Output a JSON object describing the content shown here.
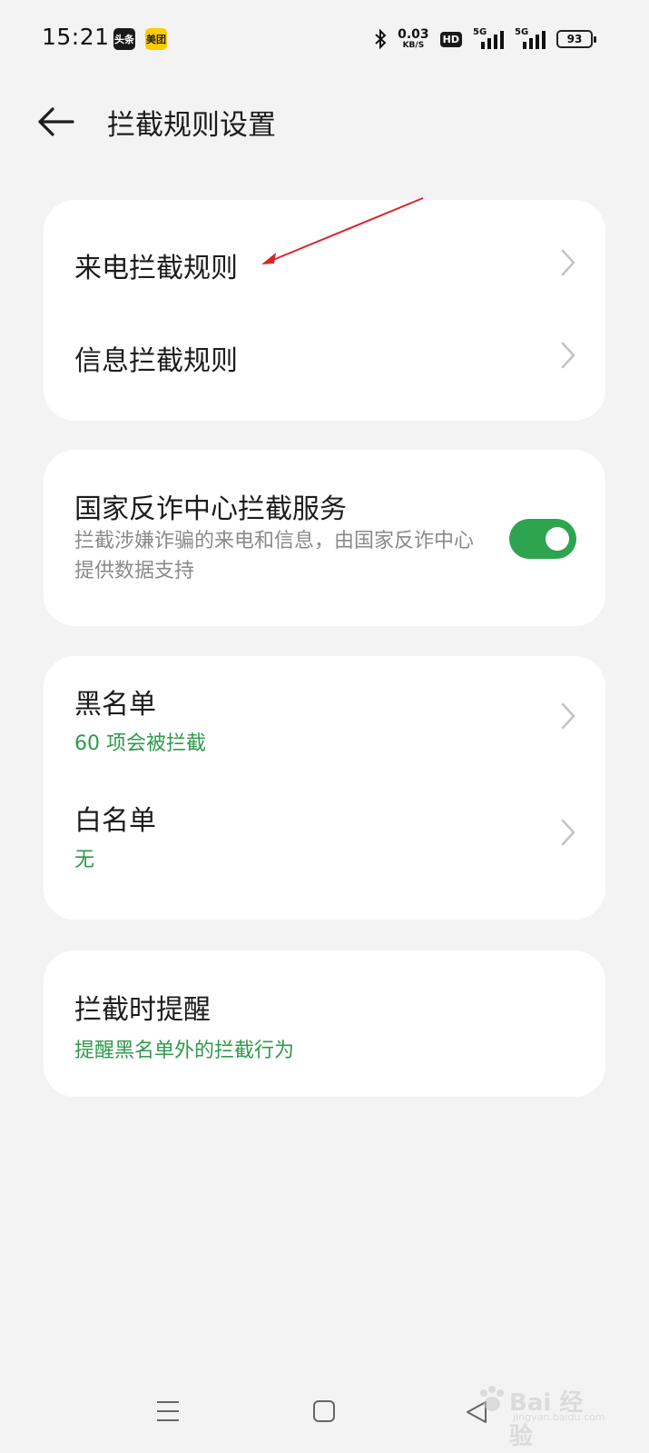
{
  "status_bar": {
    "time": "15:21",
    "app_badges": [
      "头条",
      "美团"
    ],
    "net_speed_value": "0.03",
    "net_speed_unit": "KB/S",
    "hd_label": "HD",
    "signal_1_label": "5G",
    "signal_2_label": "5G",
    "battery_level": "93"
  },
  "header": {
    "title": "拦截规则设置"
  },
  "rules_card": {
    "call_rules_label": "来电拦截规则",
    "sms_rules_label": "信息拦截规则"
  },
  "antifraud_card": {
    "title": "国家反诈中心拦截服务",
    "description": "拦截涉嫌诈骗的来电和信息，由国家反诈中心提供数据支持",
    "toggle_on": true
  },
  "lists_card": {
    "blacklist_label": "黑名单",
    "blacklist_sub": "60 项会被拦截",
    "whitelist_label": "白名单",
    "whitelist_sub": "无"
  },
  "reminder_card": {
    "title": "拦截时提醒",
    "sub": "提醒黑名单外的拦截行为"
  },
  "colors": {
    "accent_green": "#2e9a4b",
    "toggle_on": "#2ea44f",
    "annotation_red": "#d9262c"
  },
  "watermark": {
    "text": "Bai 经验",
    "sub": "jingyan.baidu.com"
  }
}
